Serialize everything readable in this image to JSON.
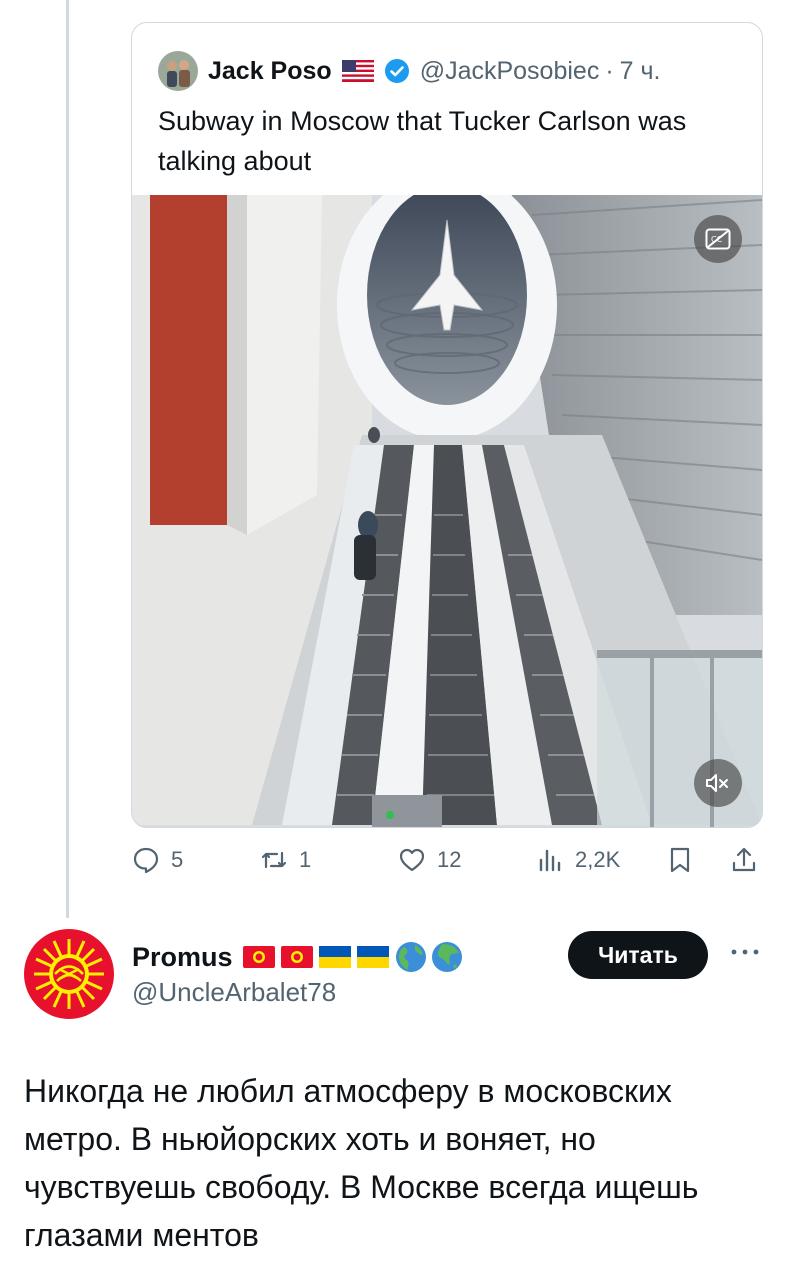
{
  "quoted_tweet": {
    "author_name": "Jack Poso",
    "author_handle": "@JackPosobiec",
    "separator": "·",
    "time": "7 ч.",
    "text": "Subway in Moscow that Tucker Carlson was talking about",
    "media": {
      "type": "video",
      "cc_icon": "closed-captions-icon",
      "mute_icon": "volume-muted-icon"
    }
  },
  "actions": {
    "replies": "5",
    "retweets": "1",
    "likes": "12",
    "views": "2,2K"
  },
  "reply_tweet": {
    "author_name": "Promus",
    "author_handle": "@UncleArbalet78",
    "follow_label": "Читать",
    "text": "Никогда не любил атмосферу в московских метро. В ньюйорских хоть и воняет, но чувствуешь свободу. В Москве всегда ищешь глазами ментов"
  },
  "colors": {
    "text_primary": "#0f1419",
    "text_secondary": "#536471",
    "border": "#cfd9de",
    "verified_blue": "#1d9bf0",
    "kg_red": "#e8112d",
    "kg_yellow": "#ffef00",
    "ua_blue": "#0057b7",
    "ua_yellow": "#ffd700"
  }
}
